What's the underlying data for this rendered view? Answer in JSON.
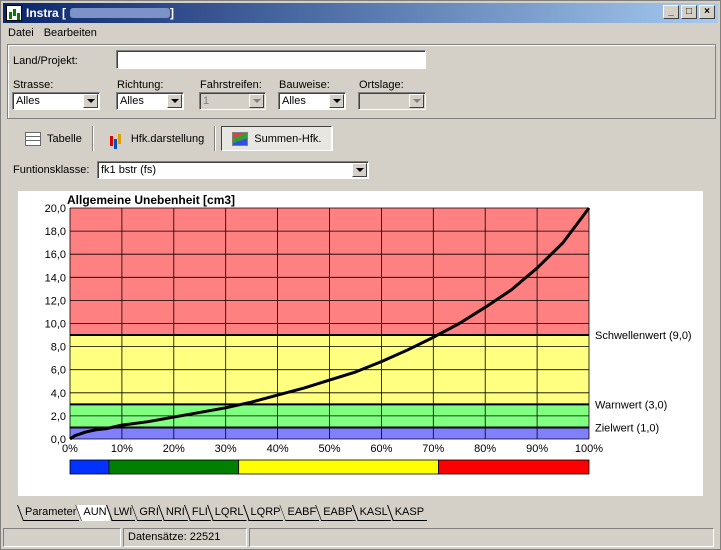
{
  "window": {
    "title": "Instra [",
    "title_suffix": "]",
    "buttons": [
      "_",
      "□",
      "×"
    ]
  },
  "menu": [
    "Datei",
    "Bearbeiten"
  ],
  "filters": {
    "land_label": "Land/Projekt:",
    "land_value": "",
    "strasse_label": "Strasse:",
    "strasse_value": "Alles",
    "richtung_label": "Richtung:",
    "richtung_value": "Alles",
    "fahrstreifen_label": "Fahrstreifen:",
    "fahrstreifen_value": "1",
    "bauweise_label": "Bauweise:",
    "bauweise_value": "Alles",
    "ortslage_label": "Ortslage:",
    "ortslage_value": ""
  },
  "view_tabs": [
    "Tabelle",
    "Hfk.darstellung",
    "Summen-Hfk."
  ],
  "funktionsklasse": {
    "label": "Funtionsklasse:",
    "value": "fk1 bstr (fs)"
  },
  "chart_data": {
    "type": "line",
    "title": "Allgemeine Unebenheit [cm3]",
    "xlabel": "",
    "ylabel": "",
    "xlim": [
      0,
      100
    ],
    "ylim": [
      0,
      20
    ],
    "x_ticks": [
      "0%",
      "10%",
      "20%",
      "30%",
      "40%",
      "50%",
      "60%",
      "70%",
      "80%",
      "90%",
      "100%"
    ],
    "y_ticks": [
      "0,0",
      "2,0",
      "4,0",
      "6,0",
      "8,0",
      "10,0",
      "12,0",
      "14,0",
      "16,0",
      "18,0",
      "20,0"
    ],
    "grid": true,
    "bands": [
      {
        "from": 0,
        "to": 1,
        "color": "#8080ff"
      },
      {
        "from": 1,
        "to": 3,
        "color": "#80ff80"
      },
      {
        "from": 3,
        "to": 9,
        "color": "#ffff80"
      },
      {
        "from": 9,
        "to": 20,
        "color": "#ff8080"
      }
    ],
    "thresholds": [
      {
        "value": 9,
        "label": "Schwellenwert (9,0)"
      },
      {
        "value": 3,
        "label": "Warnwert (3,0)"
      },
      {
        "value": 1,
        "label": "Zielwert (1,0)"
      }
    ],
    "x": [
      0,
      1,
      3,
      5,
      7,
      10,
      15,
      20,
      25,
      30,
      35,
      40,
      45,
      50,
      55,
      60,
      65,
      70,
      75,
      80,
      85,
      90,
      95,
      100
    ],
    "values": [
      0.0,
      0.3,
      0.6,
      0.8,
      0.9,
      1.2,
      1.5,
      1.9,
      2.3,
      2.7,
      3.2,
      3.8,
      4.4,
      5.1,
      5.8,
      6.7,
      7.7,
      8.8,
      10.0,
      11.4,
      12.9,
      14.8,
      17.0,
      20.0
    ],
    "color_bar": [
      {
        "from": 0,
        "to": 7.5,
        "color": "#0033ff"
      },
      {
        "from": 7.5,
        "to": 32.5,
        "color": "#008000"
      },
      {
        "from": 32.5,
        "to": 71,
        "color": "#ffff00"
      },
      {
        "from": 71,
        "to": 100,
        "color": "#ff0000"
      }
    ]
  },
  "bottom_tabs": [
    "Parameter",
    "AUN",
    "LWI",
    "GRI",
    "NRI",
    "FLI",
    "LQRL",
    "LQRP",
    "EABF",
    "EABP",
    "KASL",
    "KASP"
  ],
  "status": {
    "records": "Datensätze: 22521"
  }
}
